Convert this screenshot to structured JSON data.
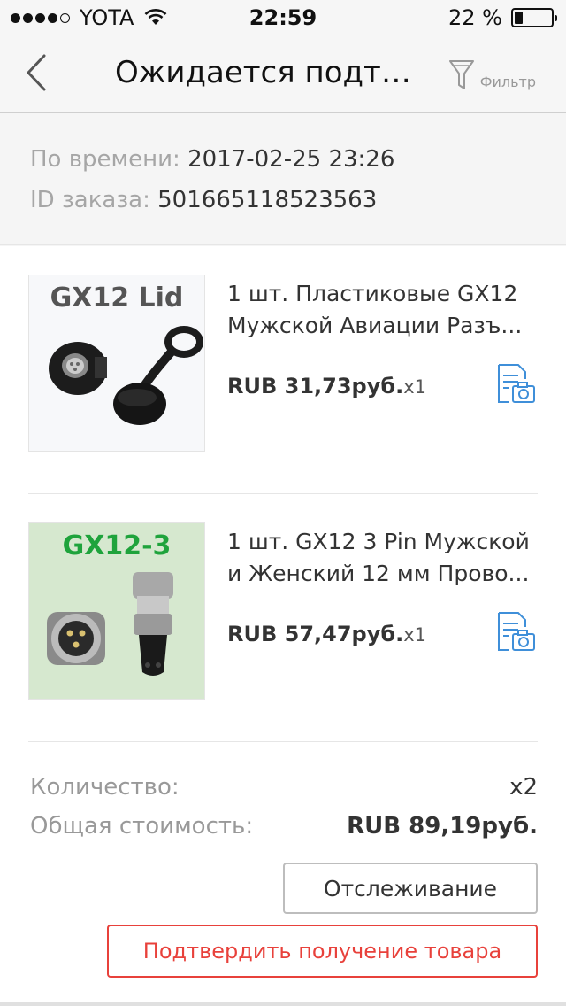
{
  "status_bar": {
    "carrier": "YOTA",
    "time": "22:59",
    "battery_text": "22 %",
    "battery_level": 0.22
  },
  "nav": {
    "title": "Ожидается подтв...",
    "filter_label": "Фильтр"
  },
  "order_info": {
    "time_label": "По времени:",
    "time_value": "2017-02-25 23:26",
    "id_label": "ID заказа:",
    "id_value": "501665118523563"
  },
  "products": [
    {
      "image_caption": "GX12 Lid",
      "image_caption_color": "#555555",
      "title_line1": "1 шт. Пластиковые GX12",
      "title_line2": "Мужской Авиации Разъ...",
      "price": "RUB 31,73руб.",
      "qty": "x1"
    },
    {
      "image_caption": "GX12-3",
      "image_caption_color": "#1fa33c",
      "title_line1": "1 шт. GX12 3 Pin Мужской",
      "title_line2": "и Женский 12 мм Прово...",
      "price": "RUB 57,47руб.",
      "qty": "x1"
    }
  ],
  "summary": {
    "quantity_label": "Количество:",
    "quantity_value": "x2",
    "total_label": "Общая стоимость:",
    "total_value": "RUB 89,19руб."
  },
  "actions": {
    "track_label": "Отслеживание",
    "confirm_label": "Подтвердить получение товара"
  },
  "colors": {
    "accent_blue": "#3f8fd9",
    "confirm_red": "#e8413b"
  }
}
